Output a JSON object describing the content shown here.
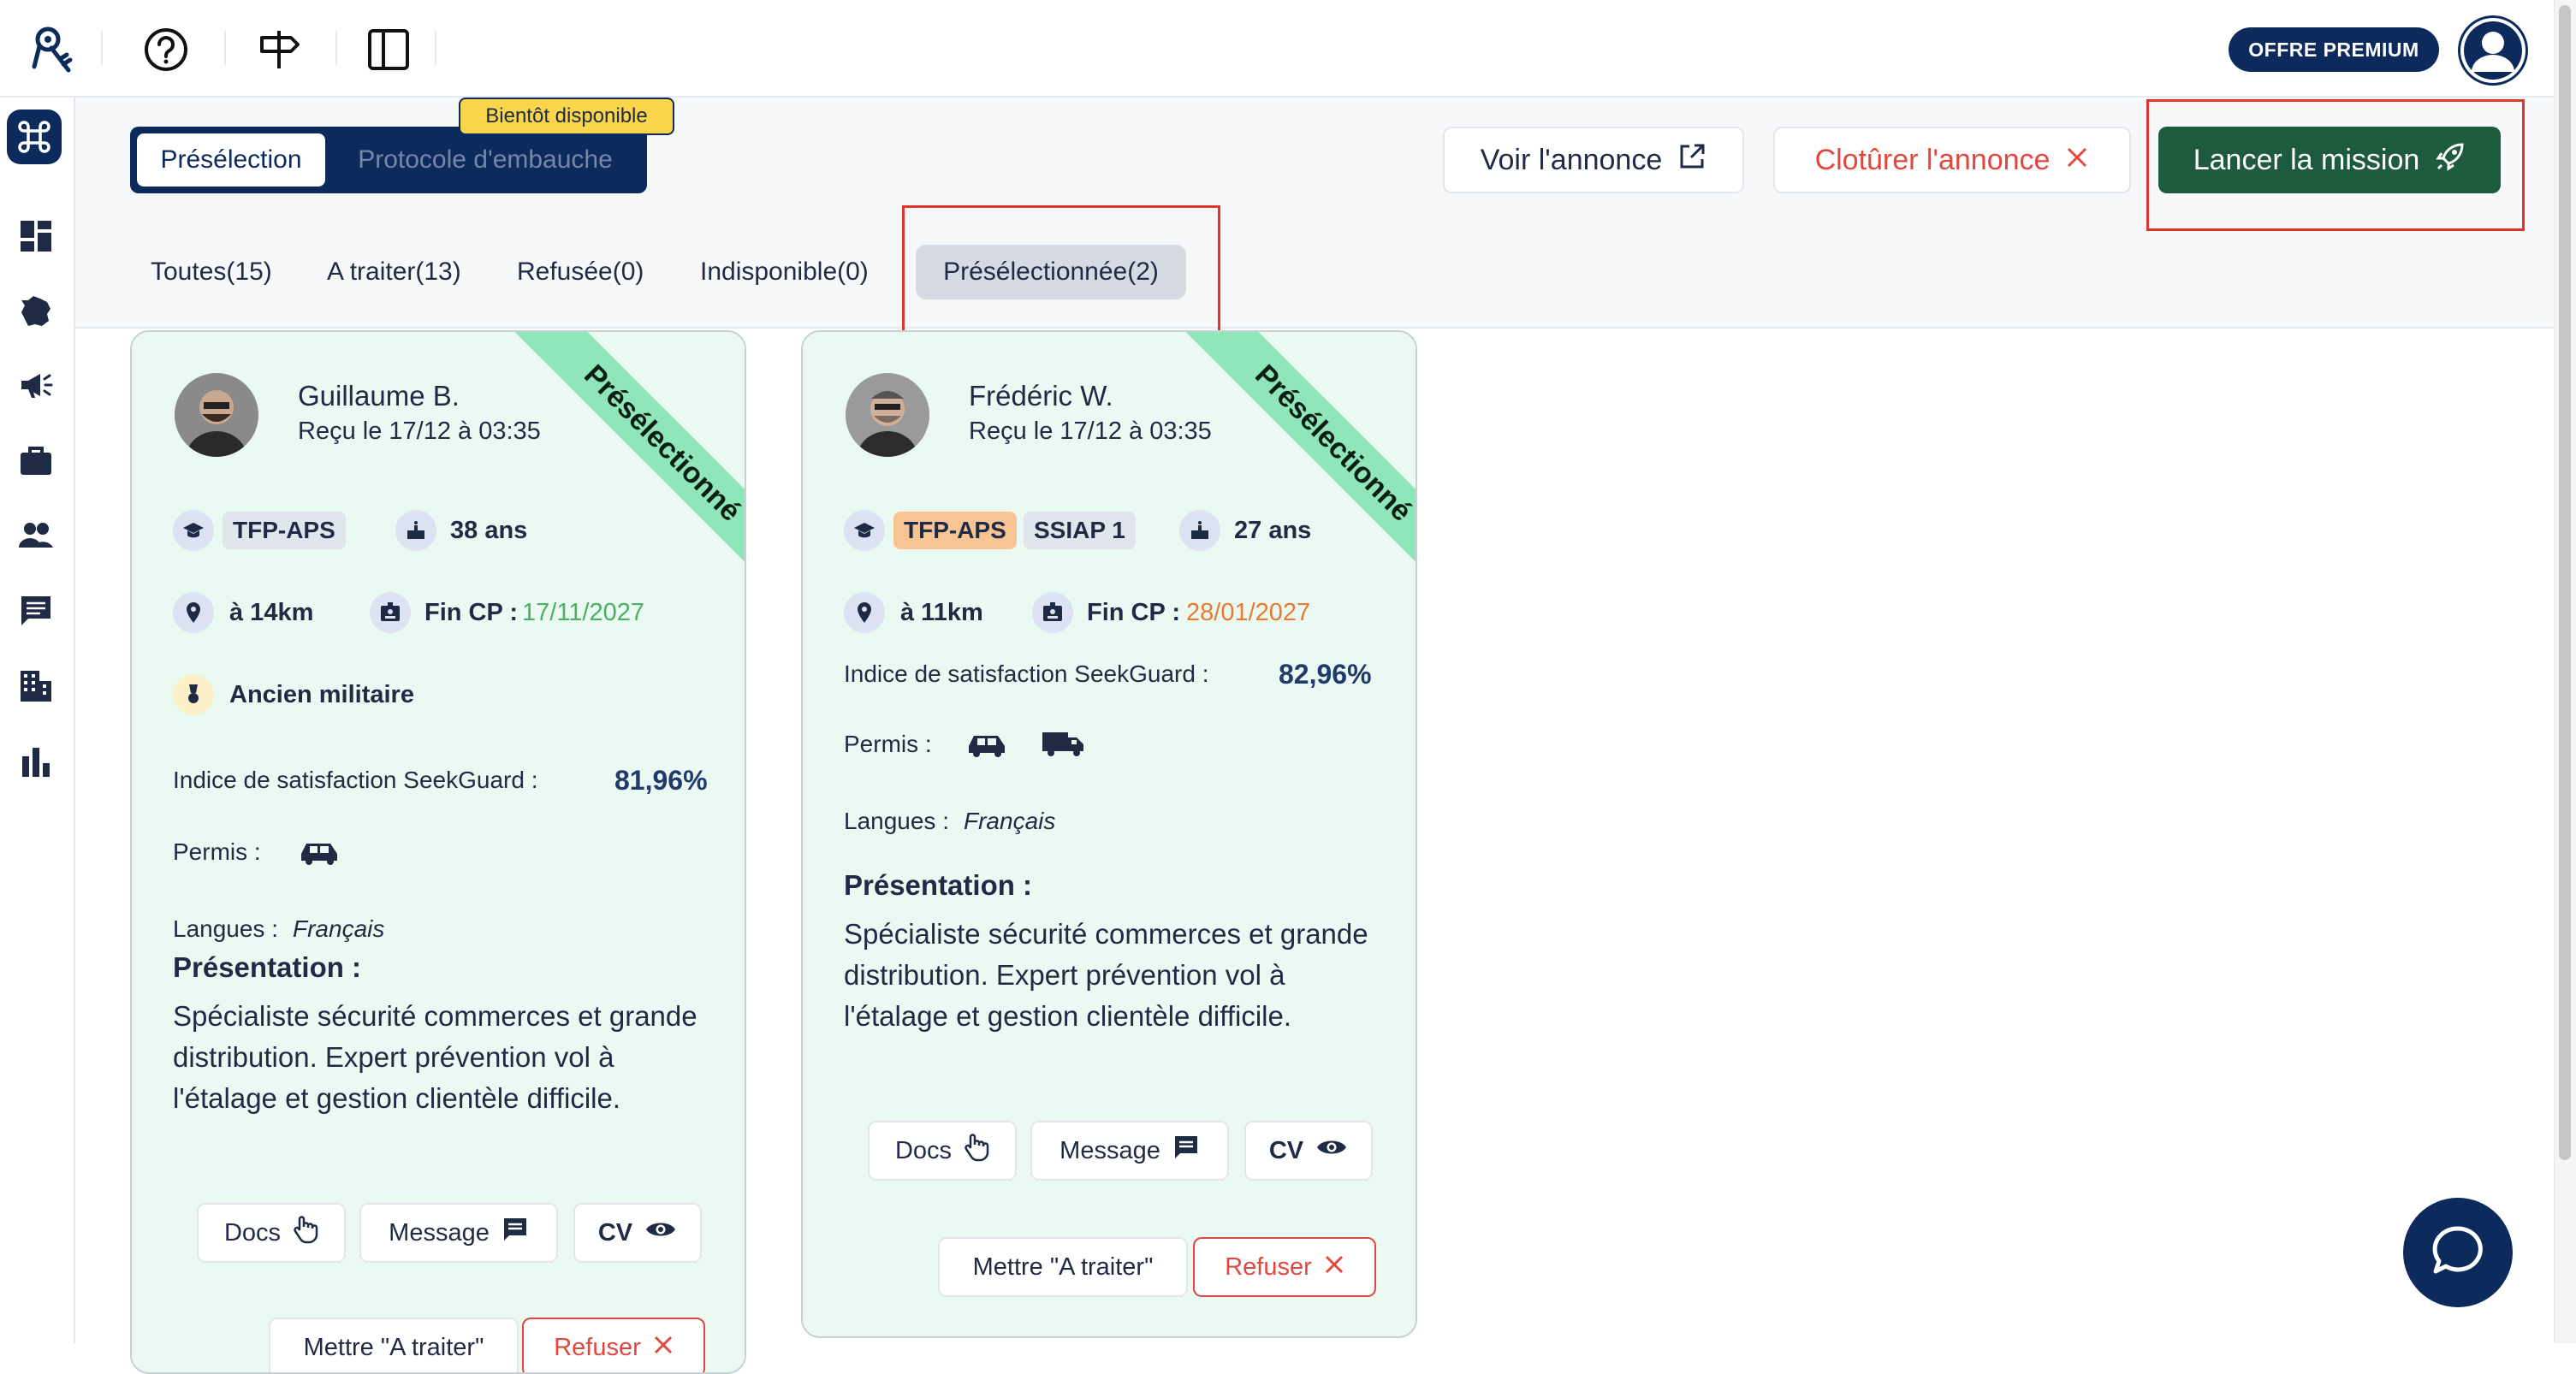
{
  "topbar": {
    "premium_label": "OFFRE PREMIUM"
  },
  "header": {
    "toggle_active": "Présélection",
    "toggle_inactive": "Protocole d'embauche",
    "soon_badge": "Bientôt disponible",
    "voir_label": "Voir l'annonce",
    "cloturer_label": "Clotûrer l'annonce",
    "lancer_label": "Lancer la mission"
  },
  "tabs": [
    {
      "label": "Toutes(15)"
    },
    {
      "label": "A traiter(13)"
    },
    {
      "label": "Refusée(0)"
    },
    {
      "label": "Indisponible(0)"
    },
    {
      "label": "Présélectionnée(2)"
    }
  ],
  "cards": [
    {
      "name": "Guillaume B.",
      "received": "Reçu le 17/12 à 03:35",
      "ribbon": "Présélectionné",
      "chips": [
        "TFP-APS"
      ],
      "age": "38 ans",
      "distance": "à 14km",
      "fin_cp_label": "Fin CP :",
      "fin_cp_value": "17/11/2027",
      "military": "Ancien militaire",
      "satisfaction_label": "Indice de satisfaction SeekGuard :",
      "satisfaction_value": "81,96%",
      "permis_label": "Permis :",
      "langues_label": "Langues :",
      "langues_value": "Français",
      "presentation_title": "Présentation :",
      "presentation_text": "Spécialiste sécurité commerces et grande distribution. Expert prévention vol à l'étalage et gestion clientèle difficile.",
      "docs": "Docs",
      "message": "Message",
      "cv": "CV",
      "mettre": "Mettre \"A traiter\"",
      "refuser": "Refuser"
    },
    {
      "name": "Frédéric W.",
      "received": "Reçu le 17/12 à 03:35",
      "ribbon": "Présélectionné",
      "chips": [
        "TFP-APS",
        "SSIAP 1"
      ],
      "age": "27 ans",
      "distance": "à 11km",
      "fin_cp_label": "Fin CP :",
      "fin_cp_value": "28/01/2027",
      "satisfaction_label": "Indice de satisfaction SeekGuard :",
      "satisfaction_value": "82,96%",
      "permis_label": "Permis :",
      "langues_label": "Langues :",
      "langues_value": "Français",
      "presentation_title": "Présentation :",
      "presentation_text": "Spécialiste sécurité commerces et grande distribution. Expert prévention vol à l'étalage et gestion clientèle difficile.",
      "docs": "Docs",
      "message": "Message",
      "cv": "CV",
      "mettre": "Mettre \"A traiter\"",
      "refuser": "Refuser"
    }
  ],
  "icons": {
    "logo": "keys-logo-icon",
    "help": "help-circle-icon",
    "signpost": "signpost-icon",
    "panel": "sidebar-panel-icon",
    "command": "command-icon"
  },
  "colors": {
    "navy": "#0d2a5c",
    "green_button": "#1e5a3e",
    "card_bg": "#eaf9f2",
    "ribbon": "#8fe6b8",
    "danger": "#e0483f"
  }
}
